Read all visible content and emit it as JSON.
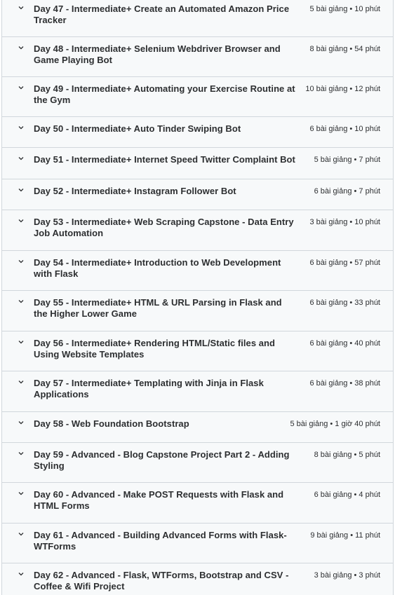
{
  "sections": [
    {
      "title": "Day 47 - Intermediate+ Create an Automated Amazon Price Tracker",
      "meta": "5 bài giảng • 10 phút"
    },
    {
      "title": "Day 48 - Intermediate+ Selenium Webdriver Browser and Game Playing Bot",
      "meta": "8 bài giảng • 54 phút"
    },
    {
      "title": "Day 49 - Intermediate+ Automating your Exercise Routine at the Gym",
      "meta": "10 bài giảng • 12 phút"
    },
    {
      "title": "Day 50 - Intermediate+ Auto Tinder Swiping Bot",
      "meta": "6 bài giảng • 10 phút"
    },
    {
      "title": "Day 51 - Intermediate+ Internet Speed Twitter Complaint Bot",
      "meta": "5 bài giảng • 7 phút"
    },
    {
      "title": "Day 52 - Intermediate+ Instagram Follower Bot",
      "meta": "6 bài giảng • 7 phút"
    },
    {
      "title": "Day 53 - Intermediate+ Web Scraping Capstone - Data Entry Job Automation",
      "meta": "3 bài giảng • 10 phút"
    },
    {
      "title": "Day 54 - Intermediate+ Introduction to Web Development with Flask",
      "meta": "6 bài giảng • 57 phút"
    },
    {
      "title": "Day 55 - Intermediate+ HTML & URL Parsing in Flask and the Higher Lower Game",
      "meta": "6 bài giảng • 33 phút"
    },
    {
      "title": "Day 56 - Intermediate+ Rendering HTML/Static files and Using Website Templates",
      "meta": "6 bài giảng • 40 phút"
    },
    {
      "title": "Day 57 - Intermediate+ Templating with Jinja in Flask Applications",
      "meta": "6 bài giảng • 38 phút"
    },
    {
      "title": "Day 58 - Web Foundation Bootstrap",
      "meta": "5 bài giảng • 1 giờ 40 phút"
    },
    {
      "title": "Day 59 - Advanced - Blog Capstone Project Part 2 - Adding Styling",
      "meta": "8 bài giảng • 5 phút"
    },
    {
      "title": "Day 60 - Advanced - Make POST Requests with Flask and HTML Forms",
      "meta": "6 bài giảng • 4 phút"
    },
    {
      "title": "Day 61 - Advanced - Building Advanced Forms with Flask-WTForms",
      "meta": "9 bài giảng • 11 phút"
    },
    {
      "title": "Day 62 - Advanced - Flask, WTForms, Bootstrap and CSV - Coffee & Wifi Project",
      "meta": "3 bài giảng • 3 phút"
    }
  ]
}
